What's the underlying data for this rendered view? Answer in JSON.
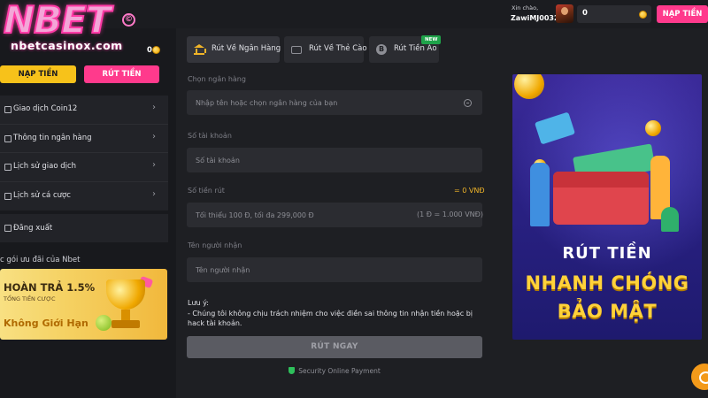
{
  "brand": {
    "logo_word": "NBET",
    "logo_reg": "©",
    "logo_site": "nbetcasinox.com"
  },
  "header": {
    "greeting": "Xin chào,",
    "username": "ZawiMJ0032",
    "balance": "0",
    "deposit_label": "NẠP TIỀN"
  },
  "sidebar": {
    "coin_value": "0",
    "deposit_label": "NẠP TIỀN",
    "withdraw_label": "RÚT TIỀN",
    "items": [
      {
        "label": "Giao dịch Coin12"
      },
      {
        "label": "Thông tin ngân hàng"
      },
      {
        "label": "Lịch sử giao dịch"
      },
      {
        "label": "Lịch sử cá cược"
      }
    ],
    "logout_label": "Đăng xuất",
    "promo_title": "c gói ưu đãi của Nbet",
    "promo": {
      "main": "HOÀN TRẢ 1.5%",
      "sub": "TỔNG TIỀN CƯỢC",
      "limit": "Không Giới Hạn"
    }
  },
  "tabs": [
    {
      "label": "Rút Về Ngân Hàng",
      "active": true
    },
    {
      "label": "Rút Về Thẻ Cào",
      "active": false
    },
    {
      "label": "Rút Tiền Ảo",
      "active": false,
      "badge": "NEW"
    }
  ],
  "form": {
    "bank_label": "Chọn ngân hàng",
    "bank_placeholder": "Nhập tên hoặc chọn ngân hàng của bạn",
    "account_label": "Số tài khoản",
    "account_placeholder": "Số tài khoản",
    "amount_label": "Số tiền rút",
    "amount_value_side": "= 0 VNĐ",
    "amount_placeholder": "Tối thiểu 100 Đ, tối đa 299,000 Đ",
    "amount_rate": "(1 Đ = 1.000 VNĐ)",
    "recipient_label": "Tên người nhận",
    "recipient_placeholder": "Tên người nhận",
    "note_title": "Lưu ý:",
    "note_text": "- Chúng tôi không chịu trách nhiệm cho việc điền sai thông tin nhận tiền hoặc bị hack tài khoản.",
    "submit_label": "RÚT NGAY",
    "secure_label": "Security Online Payment"
  },
  "banner": {
    "line1": "RÚT TIỀN",
    "line2": "NHANH CHÓNG",
    "line3": "BẢO MẬT"
  },
  "colors": {
    "accent_pink": "#ff3a8c",
    "accent_yellow": "#f7c21a",
    "background": "#18191d",
    "panel": "#222328",
    "success": "#2ec05b"
  },
  "icons": {
    "menu": [
      "exchange-icon",
      "bank-card-icon",
      "history-icon",
      "bet-history-icon"
    ],
    "logout": "logout-icon",
    "tabs": [
      "bank-icon",
      "card-icon",
      "bitcoin-icon"
    ],
    "secure": "shield-icon",
    "chat": "chat-icon"
  }
}
